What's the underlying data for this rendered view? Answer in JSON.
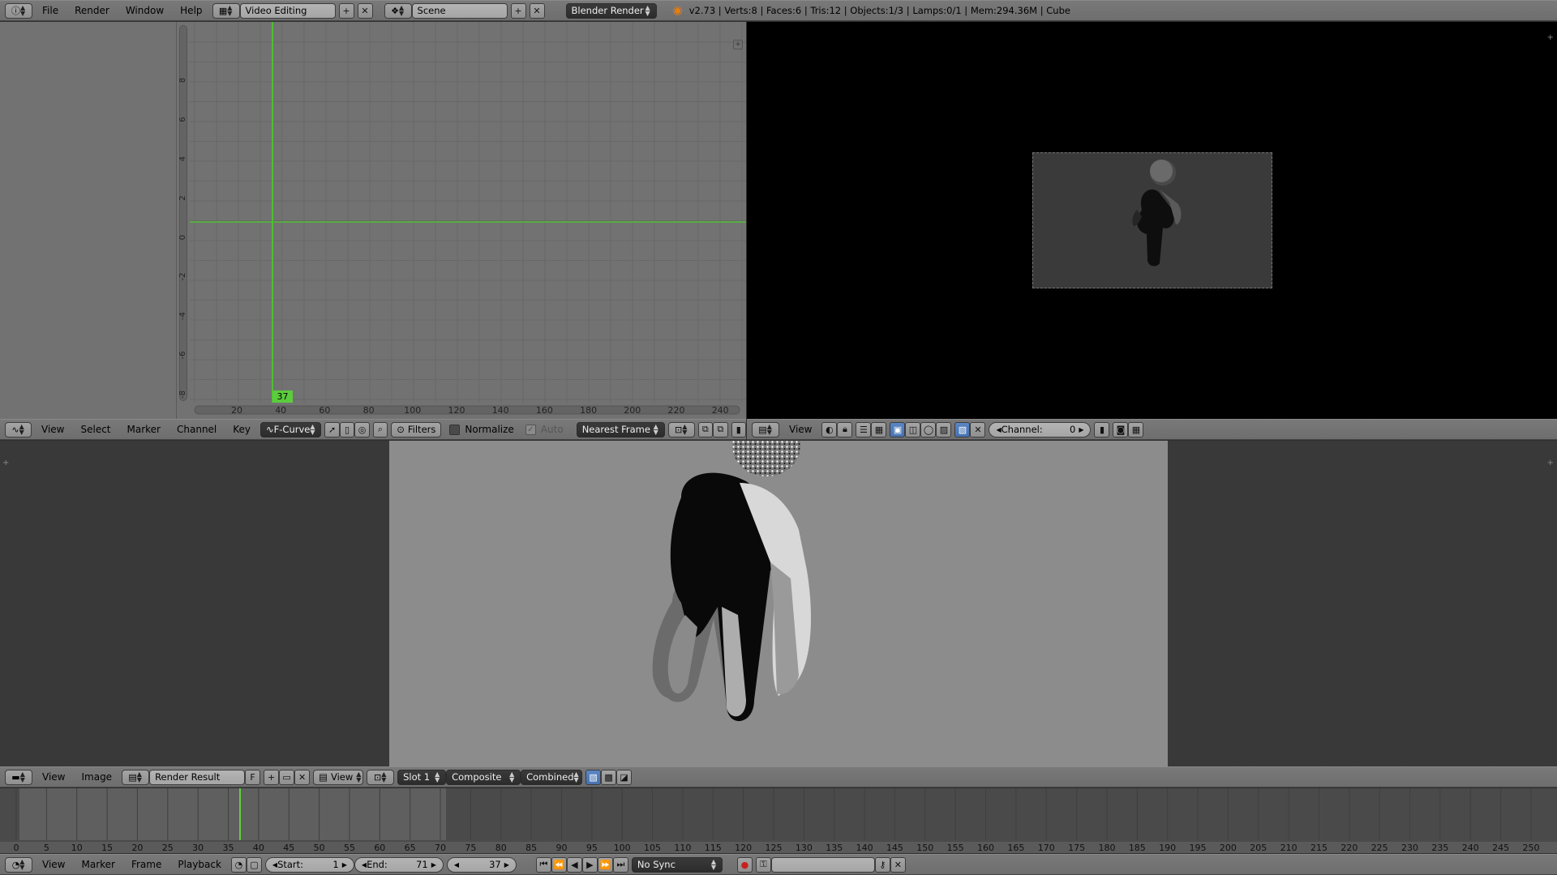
{
  "info": {
    "menus": [
      "File",
      "Render",
      "Window",
      "Help"
    ],
    "screen": "Video Editing",
    "scene": "Scene",
    "engine": "Blender Render",
    "stats": "v2.73 | Verts:8 | Faces:6 | Tris:12 | Objects:1/3 | Lamps:0/1 | Mem:294.36M | Cube"
  },
  "graph": {
    "yticks": [
      "8",
      "6",
      "4",
      "2",
      "0",
      "-2",
      "-4",
      "-6",
      "-8"
    ],
    "xticks": [
      "20",
      "40",
      "60",
      "80",
      "100",
      "120",
      "140",
      "160",
      "180",
      "200",
      "220",
      "240"
    ],
    "current_frame": "37"
  },
  "graph_header": {
    "menus": [
      "View",
      "Select",
      "Marker",
      "Channel",
      "Key"
    ],
    "mode": "F-Curve",
    "filters": "Filters",
    "normalize": "Normalize",
    "auto": "Auto",
    "snap": "Nearest Frame"
  },
  "seq_header": {
    "view": "View",
    "channel_label": "Channel:",
    "channel_value": "0"
  },
  "image_header": {
    "menus": [
      "View",
      "Image"
    ],
    "image_name": "Render Result",
    "fake_user": "F",
    "view": "View",
    "slot": "Slot 1",
    "layer": "Composite",
    "pass": "Combined"
  },
  "timeline": {
    "ticks": [
      "0",
      "5",
      "10",
      "15",
      "20",
      "25",
      "30",
      "35",
      "40",
      "45",
      "50",
      "55",
      "60",
      "65",
      "70",
      "75",
      "80",
      "85",
      "90",
      "95",
      "100",
      "105",
      "110",
      "115",
      "120",
      "125",
      "130",
      "135",
      "140",
      "145",
      "150",
      "155",
      "160",
      "165",
      "170",
      "175",
      "180",
      "185",
      "190",
      "195",
      "200",
      "205",
      "210",
      "215",
      "220",
      "225",
      "230",
      "235",
      "240",
      "245",
      "250"
    ],
    "start_frame": 0,
    "end_frame": 71,
    "current_frame": 37
  },
  "timeline_header": {
    "menus": [
      "View",
      "Marker",
      "Frame",
      "Playback"
    ],
    "start_label": "Start:",
    "start_value": "1",
    "end_label": "End:",
    "end_value": "71",
    "current": "37",
    "sync": "No Sync"
  },
  "colors": {
    "header": "#727272",
    "graph_bg": "#727272",
    "seq_bg": "#000000",
    "image_bg": "#393939",
    "render_bg": "#8c8c8c",
    "playhead": "#60d040",
    "selected": "#5680c2"
  }
}
